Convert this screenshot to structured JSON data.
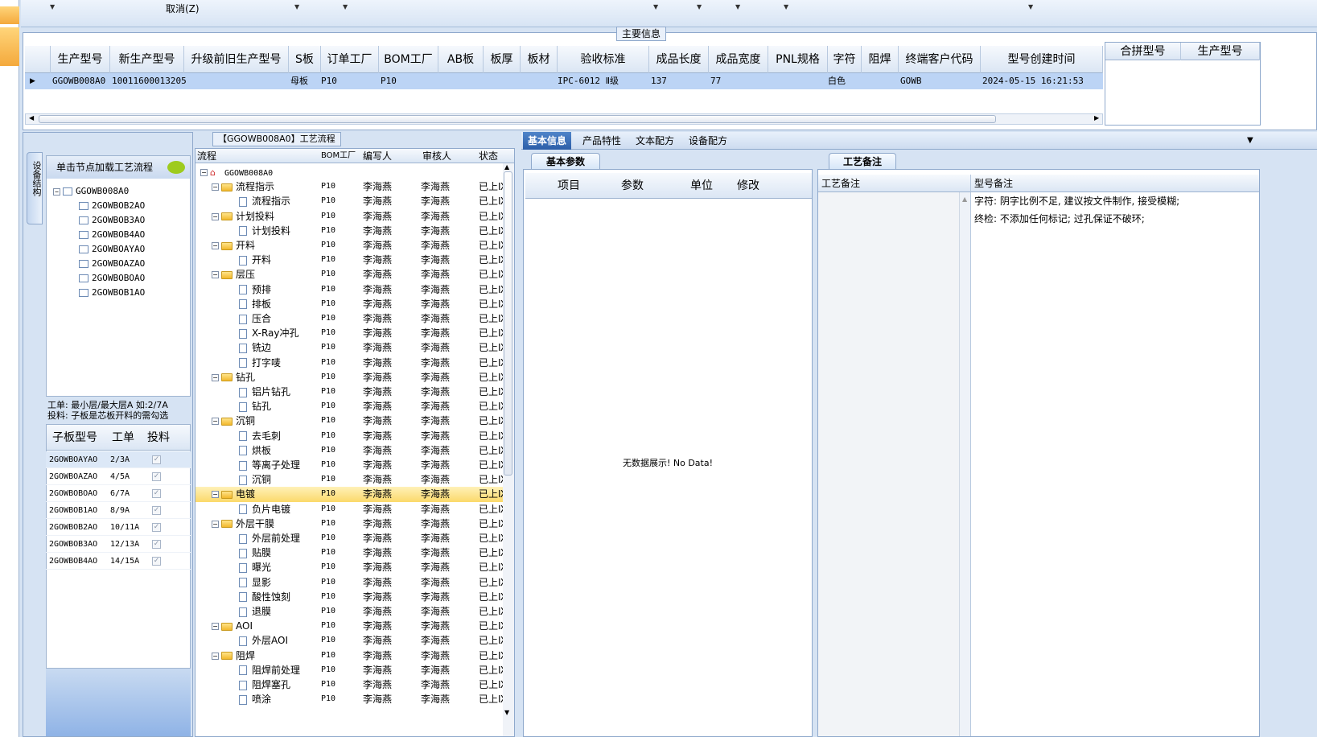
{
  "toolbar": {
    "cancel_label": "取消(Z)"
  },
  "main_info": {
    "group_title": "主要信息",
    "columns": [
      "生产型号",
      "新生产型号",
      "升级前旧生产型号",
      "S板",
      "订单工厂",
      "BOM工厂",
      "AB板",
      "板厚",
      "板材",
      "验收标准",
      "成品长度",
      "成品宽度",
      "PNL规格",
      "字符",
      "阻焊",
      "终端客户代码",
      "型号创建时间"
    ],
    "row": {
      "prod_model": "GGOWB008A0",
      "new_prod_model": "10011600013205",
      "s_board": "母板",
      "order_factory": "P10",
      "bom_factory": "P10",
      "acceptance": "IPC-6012 Ⅱ级",
      "length": "137",
      "width": "77",
      "char": "白色",
      "customer": "GOWB",
      "created": "2024-05-15 16:21:53"
    },
    "merge_columns": [
      "合拼型号",
      "生产型号"
    ]
  },
  "left_panel": {
    "vtab_label": "设备结构",
    "tree_header": "单击节点加载工艺流程",
    "tree_root": "GGOWB008A0",
    "tree_children": [
      "2GOWBOB2AO",
      "2GOWBOB3AO",
      "2GOWBOB4AO",
      "2GOWBOAYAO",
      "2GOWBOAZAO",
      "2GOWBOBOAO",
      "2GOWBOB1AO"
    ],
    "note_line1": "工单: 最小层/最大层A 如:2/7A",
    "note_line2": "投料: 子板是芯板开料的需勾选",
    "sub_columns": [
      "子板型号",
      "工单",
      "投料"
    ],
    "sub_rows": [
      {
        "model": "2GOWBOAYAO",
        "order": "2/3A"
      },
      {
        "model": "2GOWBOAZAO",
        "order": "4/5A"
      },
      {
        "model": "2GOWBOBOAO",
        "order": "6/7A"
      },
      {
        "model": "2GOWBOB1AO",
        "order": "8/9A"
      },
      {
        "model": "2GOWBOB2AO",
        "order": "10/11A"
      },
      {
        "model": "2GOWBOB3AO",
        "order": "12/13A"
      },
      {
        "model": "2GOWBOB4AO",
        "order": "14/15A"
      }
    ]
  },
  "flow": {
    "group_title": "【GGOWB008A0】工艺流程",
    "columns": [
      "流程",
      "BOM工厂",
      "编写人",
      "审核人",
      "状态"
    ],
    "root": "GGOWB008A0",
    "bom": "P10",
    "writer": "李海燕",
    "reviewer": "李海燕",
    "status": "已上Ⅸ",
    "rows": [
      {
        "t": "f",
        "n": "流程指示"
      },
      {
        "t": "d",
        "n": "流程指示"
      },
      {
        "t": "f",
        "n": "计划投料"
      },
      {
        "t": "d",
        "n": "计划投料"
      },
      {
        "t": "f",
        "n": "开料"
      },
      {
        "t": "d",
        "n": "开料"
      },
      {
        "t": "f",
        "n": "层压"
      },
      {
        "t": "d",
        "n": "预排"
      },
      {
        "t": "d",
        "n": "排板"
      },
      {
        "t": "d",
        "n": "压合"
      },
      {
        "t": "d",
        "n": "X-Ray冲孔"
      },
      {
        "t": "d",
        "n": "铣边"
      },
      {
        "t": "d",
        "n": "打字唛"
      },
      {
        "t": "f",
        "n": "钻孔"
      },
      {
        "t": "d",
        "n": "铝片钻孔"
      },
      {
        "t": "d",
        "n": "钻孔"
      },
      {
        "t": "f",
        "n": "沉铜"
      },
      {
        "t": "d",
        "n": "去毛刺"
      },
      {
        "t": "d",
        "n": "烘板"
      },
      {
        "t": "d",
        "n": "等离子处理"
      },
      {
        "t": "d",
        "n": "沉铜"
      },
      {
        "t": "f",
        "n": "电镀",
        "sel": true
      },
      {
        "t": "d",
        "n": "负片电镀"
      },
      {
        "t": "f",
        "n": "外层干膜"
      },
      {
        "t": "d",
        "n": "外层前处理"
      },
      {
        "t": "d",
        "n": "贴膜"
      },
      {
        "t": "d",
        "n": "曝光"
      },
      {
        "t": "d",
        "n": "显影"
      },
      {
        "t": "d",
        "n": "酸性蚀刻"
      },
      {
        "t": "d",
        "n": "退膜"
      },
      {
        "t": "f",
        "n": "AOI"
      },
      {
        "t": "d",
        "n": "外层AOI"
      },
      {
        "t": "f",
        "n": "阻焊"
      },
      {
        "t": "d",
        "n": "阻焊前处理"
      },
      {
        "t": "d",
        "n": "阻焊塞孔"
      },
      {
        "t": "d",
        "n": "喷涂"
      }
    ]
  },
  "tabs": [
    "基本信息",
    "产品特性",
    "文本配方",
    "设备配方"
  ],
  "basic": {
    "card_title": "基本参数",
    "columns": [
      "项目",
      "参数",
      "单位",
      "修改"
    ],
    "empty_text": "无数据展示! No Data!"
  },
  "notes": {
    "card_title": "工艺备注",
    "col1": "工艺备注",
    "col2": "型号备注",
    "line1": "字符: 阴字比例不足, 建议按文件制作, 接受模糊;",
    "line2": "终检: 不添加任何标记; 过孔保证不破环;"
  }
}
